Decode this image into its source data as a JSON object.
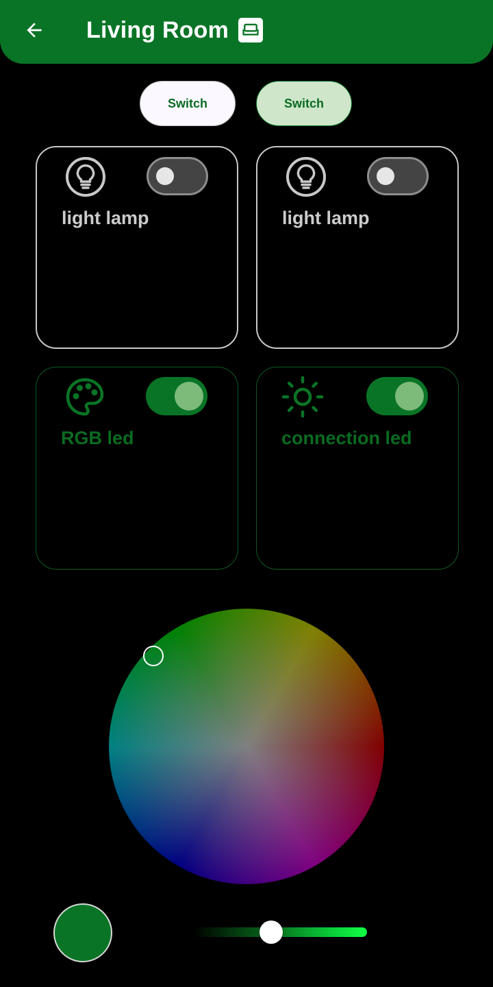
{
  "header": {
    "title": "Living Room",
    "back_icon": "arrow-left-icon",
    "room_icon": "sofa-icon",
    "background_color": "#0a7426"
  },
  "chips": [
    {
      "label": "Switch",
      "selected": false
    },
    {
      "label": "Switch",
      "selected": true
    }
  ],
  "devices": [
    {
      "label": "light lamp",
      "icon": "lightbulb-icon",
      "on": false
    },
    {
      "label": "light lamp",
      "icon": "lightbulb-icon",
      "on": false
    },
    {
      "label": "RGB led",
      "icon": "palette-icon",
      "on": true
    },
    {
      "label": "connection led",
      "icon": "sun-icon",
      "on": true
    }
  ],
  "color_picker": {
    "selected_color": "#0a7426",
    "brightness": 0.45
  },
  "colors": {
    "accent": "#0a7426",
    "card_border": "#c8c8c8",
    "background": "#000000"
  }
}
